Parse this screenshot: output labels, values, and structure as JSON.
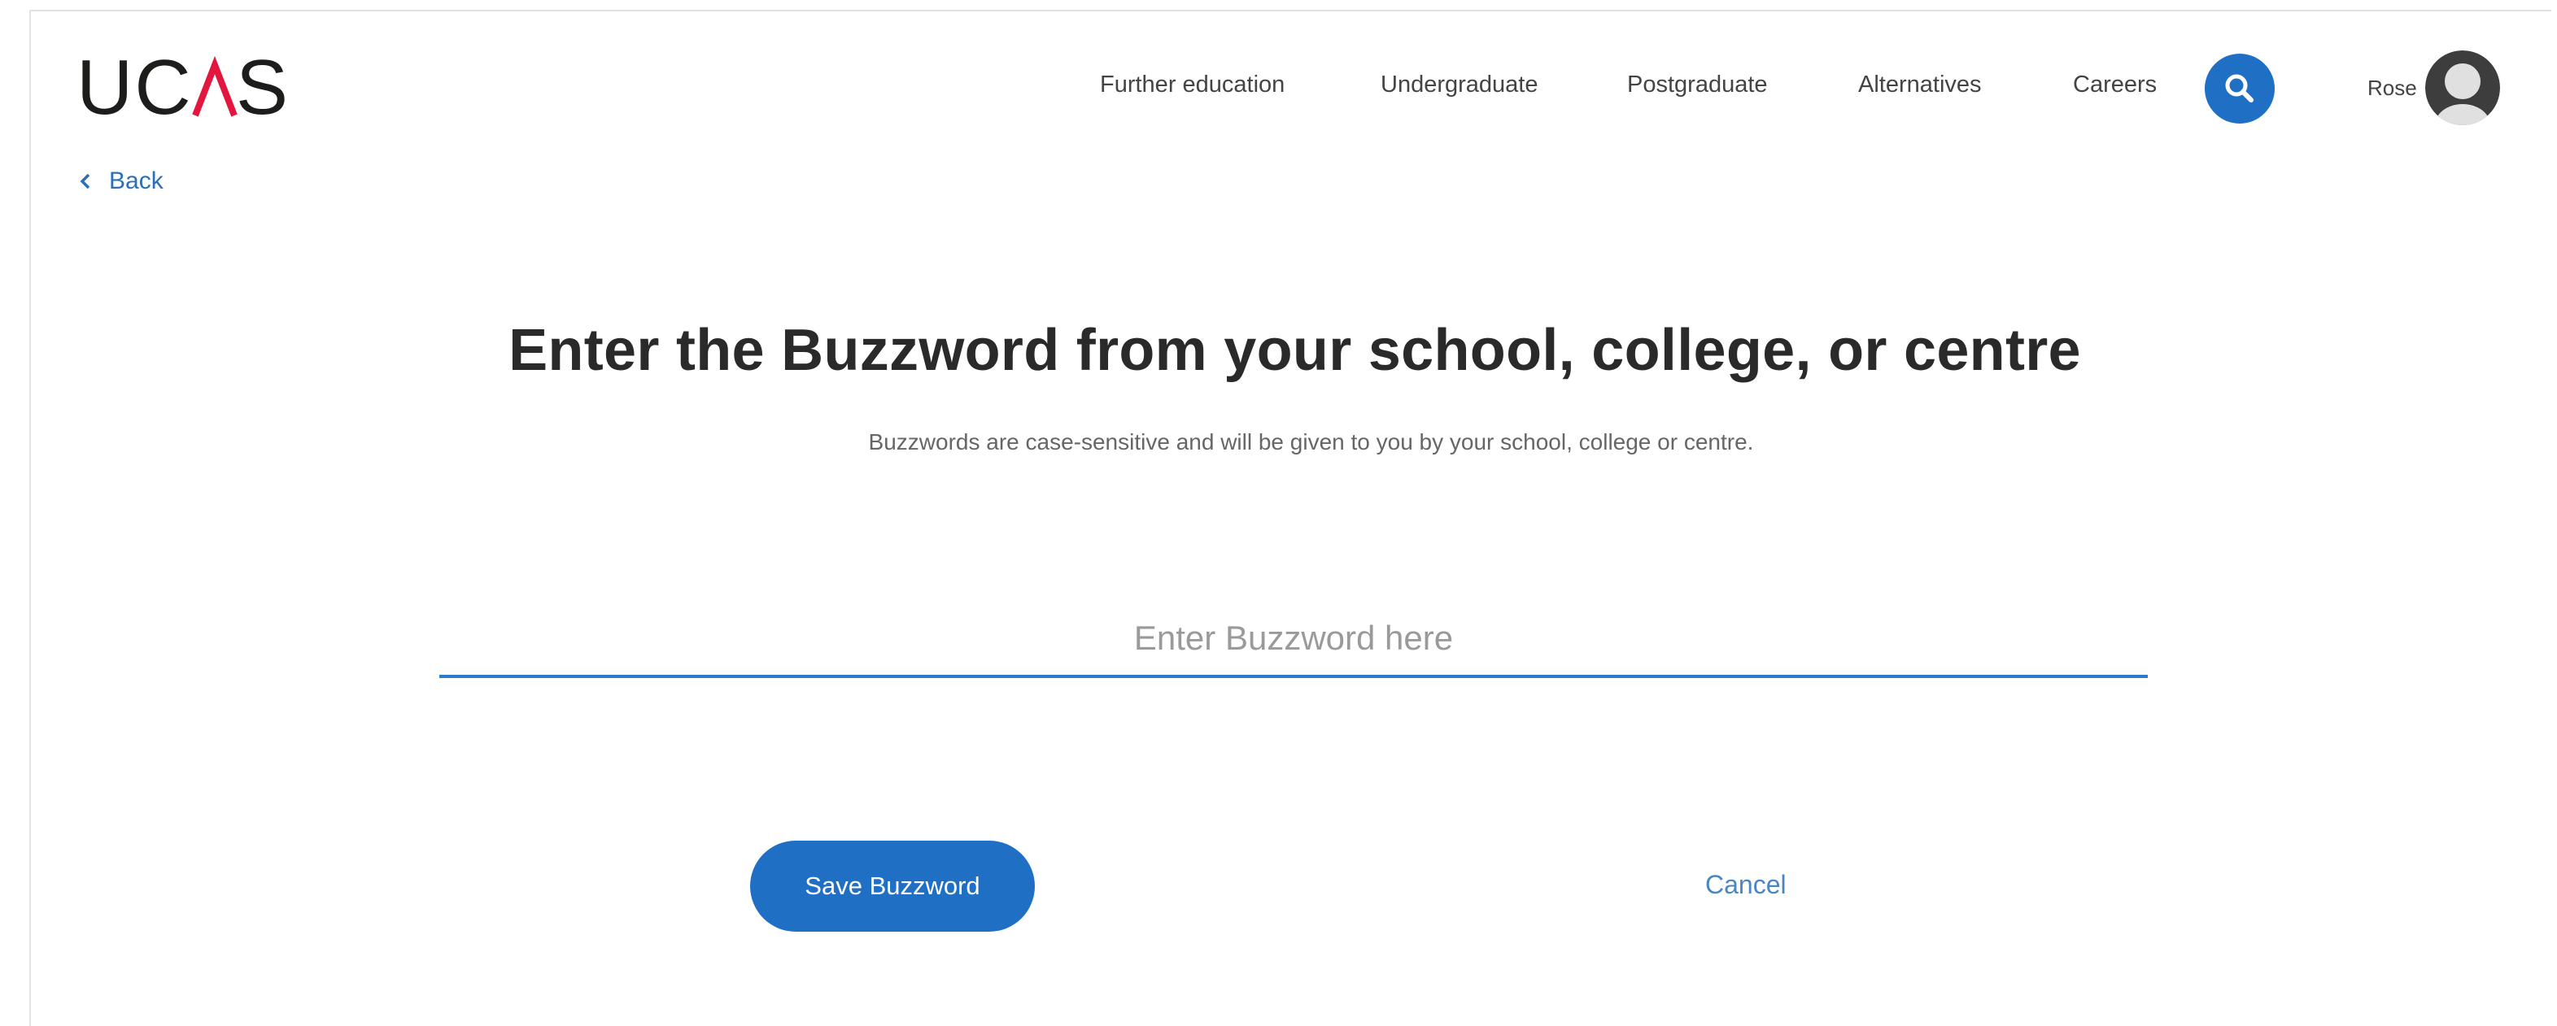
{
  "brand": {
    "logo_text": "UCAS",
    "accent_color": "#e3163d",
    "primary_color": "#1f6fc5"
  },
  "back": {
    "icon": "chevron-left-icon",
    "label": "Back"
  },
  "nav": {
    "items": [
      {
        "label": "Further education"
      },
      {
        "label": "Undergraduate"
      },
      {
        "label": "Postgraduate"
      },
      {
        "label": "Alternatives"
      },
      {
        "label": "Careers"
      }
    ],
    "search_icon": "search-icon"
  },
  "user": {
    "name": "Rose",
    "avatar_icon": "user-avatar-icon"
  },
  "main": {
    "title": "Enter the Buzzword from your school, college, or centre",
    "subtitle": "Buzzwords are case-sensitive and will be given to you by your school, college or centre.",
    "input": {
      "placeholder": "Enter Buzzword here",
      "value": ""
    },
    "save_label": "Save Buzzword",
    "cancel_label": "Cancel"
  }
}
